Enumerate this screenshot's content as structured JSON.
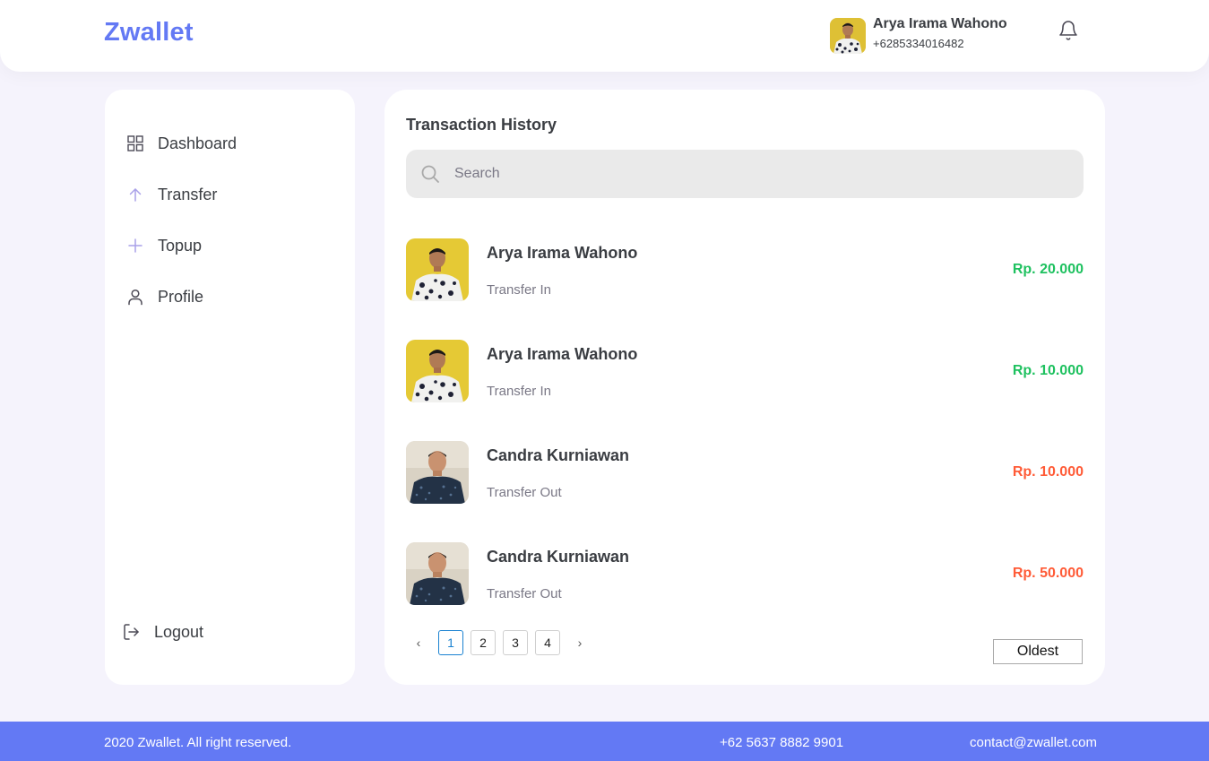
{
  "header": {
    "brand": "Zwallet",
    "user_name": "Arya Irama Wahono",
    "user_phone": "+6285334016482",
    "bell_icon": "bell-icon"
  },
  "sidebar": {
    "items": [
      {
        "label": "Dashboard",
        "icon": "grid-icon"
      },
      {
        "label": "Transfer",
        "icon": "arrow-up-icon"
      },
      {
        "label": "Topup",
        "icon": "plus-icon"
      },
      {
        "label": "Profile",
        "icon": "user-icon"
      }
    ],
    "logout": {
      "label": "Logout",
      "icon": "logout-icon"
    }
  },
  "main": {
    "title": "Transaction History",
    "search": {
      "placeholder": "Search",
      "value": ""
    },
    "transactions": [
      {
        "name": "Arya Irama Wahono",
        "type": "Transfer In",
        "amount": "Rp. 20.000",
        "direction": "in"
      },
      {
        "name": "Arya Irama Wahono",
        "type": "Transfer In",
        "amount": "Rp. 10.000",
        "direction": "in"
      },
      {
        "name": "Candra Kurniawan",
        "type": "Transfer Out",
        "amount": "Rp. 10.000",
        "direction": "out"
      },
      {
        "name": "Candra Kurniawan",
        "type": "Transfer Out",
        "amount": "Rp. 50.000",
        "direction": "out"
      }
    ],
    "pagination": {
      "prev": "‹",
      "next": "›",
      "pages": [
        "1",
        "2",
        "3",
        "4"
      ],
      "current": "1"
    },
    "sort": {
      "selected": "Oldest"
    }
  },
  "footer": {
    "copyright": "2020 Zwallet. All right reserved.",
    "phone": "+62 5637 8882 9901",
    "email": "contact@zwallet.com"
  },
  "colors": {
    "brand": "#6379f4",
    "income": "#1ec15f",
    "expense": "#ff5b37",
    "background": "#f5f3fc"
  }
}
